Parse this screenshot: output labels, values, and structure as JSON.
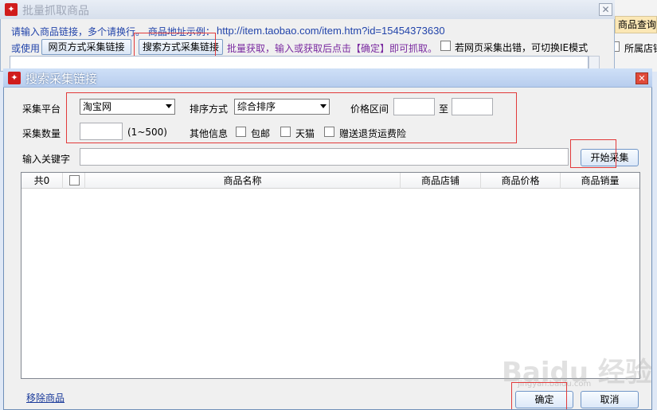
{
  "background_window": {
    "title": "批量抓取商品",
    "close_glyph": "✕",
    "instruction_prefix": "请输入商品链接，多个请换行。 商品地址示例：",
    "example_url": "http://item.taobao.com/item.htm?id=15454373630",
    "or_use": "或使用",
    "web_collect_button": "网页方式采集链接",
    "search_collect_button": "搜索方式采集链接",
    "batch_hint": "批量获取，输入或获取后点击【确定】即可抓取。",
    "ie_mode_label": "若网页采集出错，可切换IE模式"
  },
  "right_strip": {
    "query_button": "商品查询",
    "store_label": "所属店铺"
  },
  "dialog": {
    "title": "搜索采集链接",
    "close_glyph": "✕",
    "platform_label": "采集平台",
    "platform_value": "淘宝网",
    "sort_label": "排序方式",
    "sort_value": "综合排序",
    "price_label": "价格区间",
    "price_to": "至",
    "price_min": "",
    "price_max": "",
    "count_label": "采集数量",
    "count_value": "",
    "count_range": "(1~500)",
    "other_label": "其他信息",
    "opt_free_shipping": "包邮",
    "opt_tmall": "天猫",
    "opt_return_insurance": "赠送退货运费险",
    "keyword_label": "输入关键字",
    "keyword_value": "",
    "start_button": "开始采集",
    "table": {
      "count_header": "共0",
      "columns": [
        "商品名称",
        "商品店铺",
        "商品价格",
        "商品销量"
      ],
      "rows": []
    },
    "remove_link": "移除商品",
    "ok_button": "确定",
    "cancel_button": "取消"
  },
  "watermark": {
    "text": "Baidu 经验",
    "sub": "jingyan.baidu.com"
  },
  "colors": {
    "annotation_red": "#e23a3a",
    "instruction_blue": "#2244aa",
    "hint_purple": "#7a2aa0"
  }
}
